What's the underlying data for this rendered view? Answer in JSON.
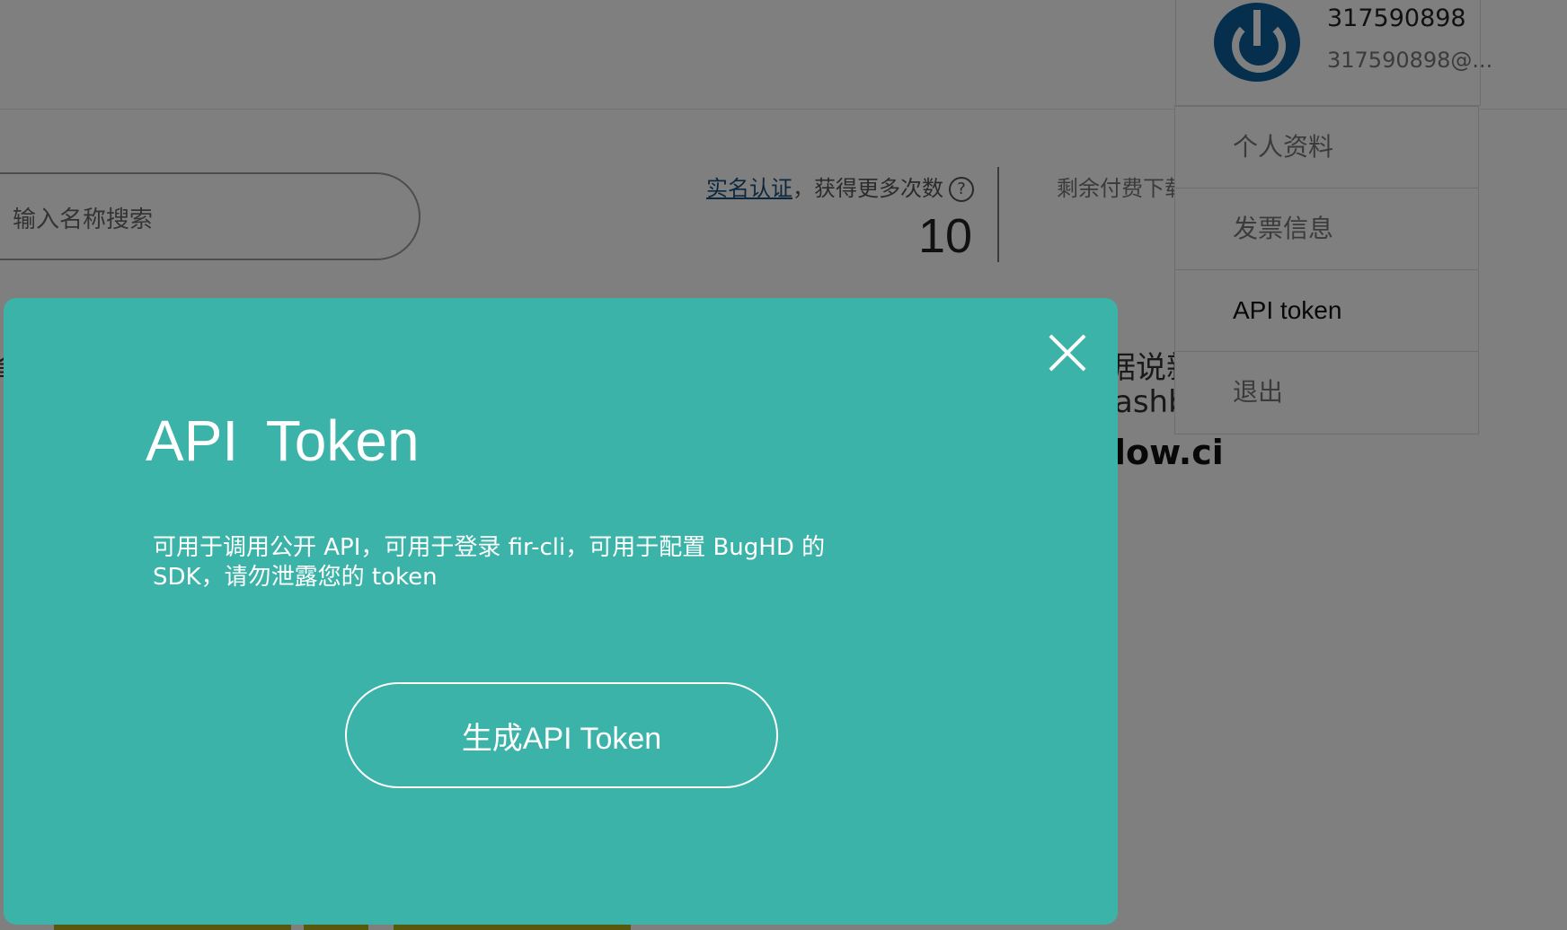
{
  "search": {
    "placeholder": "输入名称搜索"
  },
  "quota": {
    "verify_link": "实名认证",
    "verify_suffix": "，获得更多次数",
    "help_icon": "?",
    "count": "10",
    "paid_label": "剩余付费下载"
  },
  "background": {
    "text1": "据说新",
    "text2": "ashb",
    "text3": "low.ci",
    "left_char": "省"
  },
  "user": {
    "name": "317590898",
    "email": "317590898@..."
  },
  "menu": {
    "items": [
      {
        "label": "个人资料"
      },
      {
        "label": "发票信息"
      },
      {
        "label": "API token"
      },
      {
        "label": "退出"
      }
    ]
  },
  "modal": {
    "title": "API  Token",
    "description": "可用于调用公开 API，可用于登录 fir-cli，可用于配置 BugHD 的 SDK，请勿泄露您的 token",
    "button": "生成API Token",
    "accent_color": "#3cb3a8"
  }
}
